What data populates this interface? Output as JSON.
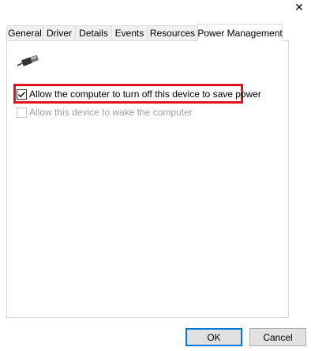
{
  "window": {
    "close_glyph": "✕"
  },
  "tabs": [
    {
      "label": "General"
    },
    {
      "label": "Driver"
    },
    {
      "label": "Details"
    },
    {
      "label": "Events"
    },
    {
      "label": "Resources"
    },
    {
      "label": "Power Management",
      "active": true
    }
  ],
  "power": {
    "device_icon": "usb-cable-icon",
    "allow_turn_off": {
      "label": "Allow the computer to turn off this device to save power",
      "checked": true
    },
    "allow_wake": {
      "label": "Allow this device to wake the computer",
      "checked": false,
      "enabled": false
    }
  },
  "highlight_color": "#e0141e",
  "buttons": {
    "ok": "OK",
    "cancel": "Cancel"
  }
}
